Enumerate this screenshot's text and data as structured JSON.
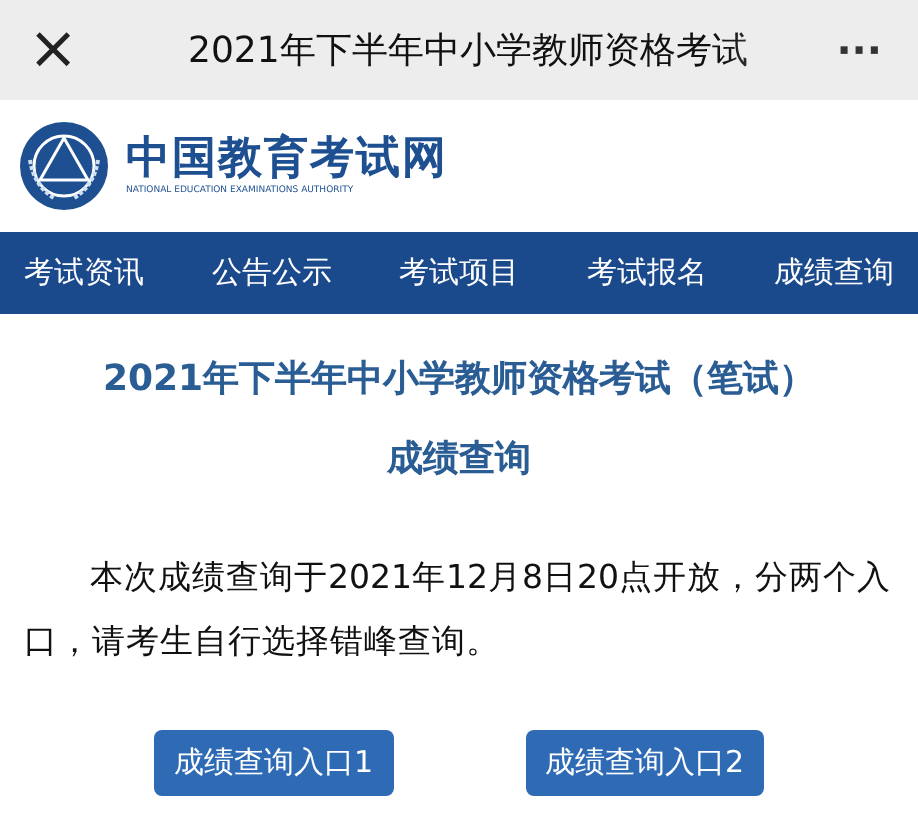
{
  "title_bar": {
    "close_icon": "×",
    "title": "2021年下半年中小学教师资格考试",
    "more": "···"
  },
  "logo": {
    "name": "中国教育考试网",
    "subtitle": "NATIONAL EDUCATION EXAMINATIONS AUTHORITY"
  },
  "nav": [
    {
      "label": "考试资讯"
    },
    {
      "label": "公告公示"
    },
    {
      "label": "考试项目"
    },
    {
      "label": "考试报名"
    },
    {
      "label": "成绩查询"
    }
  ],
  "heading": [
    "2021年下半年中小学教师资格考试（笔试）",
    "成绩查询"
  ],
  "notice": "本次成绩查询于2021年12月8日20点开放，分两个入口，请考生自行选择错峰查询。",
  "buttons": [
    "成绩查询入口1",
    "成绩查询入口2"
  ]
}
